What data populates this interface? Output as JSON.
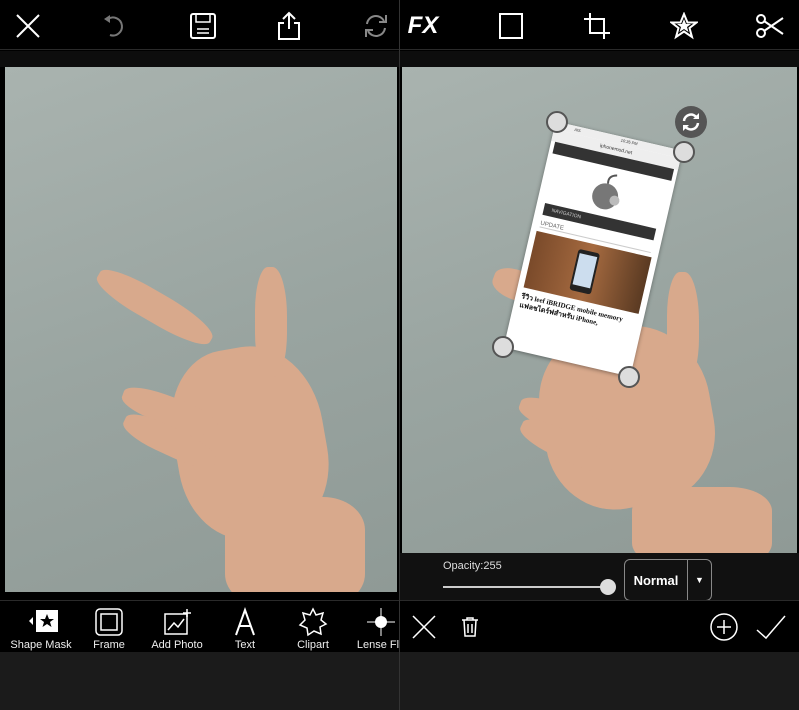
{
  "left_panel": {
    "toolbar": [
      "close-icon",
      "undo-icon",
      "save-icon",
      "share-icon",
      "refresh-icon"
    ],
    "tools": [
      {
        "label": "Shape Mask",
        "icon": "star-square-icon"
      },
      {
        "label": "Frame",
        "icon": "frame-icon"
      },
      {
        "label": "Add Photo",
        "icon": "add-photo-icon"
      },
      {
        "label": "Text",
        "icon": "text-icon"
      },
      {
        "label": "Clipart",
        "icon": "clipart-icon"
      },
      {
        "label": "Lense Fla",
        "icon": "lens-flare-icon"
      }
    ]
  },
  "right_panel": {
    "toolbar": {
      "fx_label": "FX",
      "icons": [
        "fx-icon",
        "square-icon",
        "crop-icon",
        "star-icon",
        "scissors-icon"
      ]
    },
    "inset": {
      "status_time": "10:35 PM",
      "status_carrier": "AIS",
      "url": "iphonemod.net",
      "nav_label": "NAVIGATION",
      "section": "UPDATE",
      "headline": "รีวิว leef iBRIDGE mobile memory แฟลชไดร์ฟสำหรับ iPhone,"
    },
    "opacity_label": "Opacity:255",
    "opacity_value": 255,
    "opacity_max": 255,
    "blend_mode": "Normal",
    "dropdown_arrow": "▼"
  }
}
